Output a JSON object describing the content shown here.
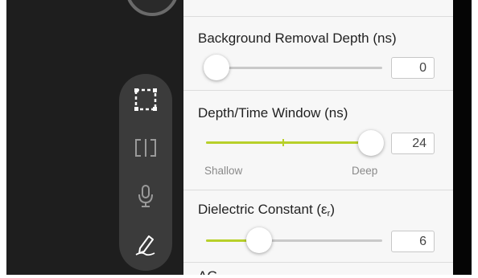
{
  "settings": [
    {
      "label": "Background Removal Depth (ns)",
      "value": "0",
      "level": 0.0
    },
    {
      "label": "Depth/Time Window (ns)",
      "value": "24",
      "level": 1.0,
      "min_label": "Shallow",
      "max_label": "Deep"
    },
    {
      "label_prefix": "Dielectric Constant (ε",
      "label_sub": "r",
      "label_suffix": ")",
      "value": "6",
      "level": 0.3
    },
    {
      "label_partial": "AG"
    }
  ],
  "toolbar": {
    "tools": [
      "select-rectangle-icon",
      "split-view-icon",
      "microphone-icon",
      "pen-icon"
    ]
  },
  "colors": {
    "accent": "#b8d02a",
    "panel_bg": "#f7f7f7",
    "app_bg": "#1e1e1e",
    "toolbar_bg": "#3b3b3b"
  }
}
